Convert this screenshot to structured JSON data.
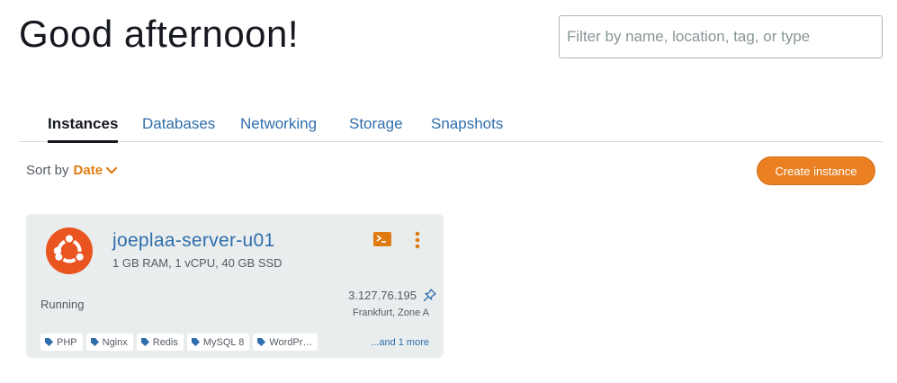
{
  "header": {
    "greeting": "Good afternoon!",
    "filter_placeholder": "Filter by name, location, tag, or type"
  },
  "tabs": [
    {
      "label": "Instances",
      "active": true
    },
    {
      "label": "Databases",
      "active": false
    },
    {
      "label": "Networking",
      "active": false
    },
    {
      "label": "Storage",
      "active": false
    },
    {
      "label": "Snapshots",
      "active": false
    }
  ],
  "toolbar": {
    "sort_label": "Sort by",
    "sort_value": "Date",
    "create_label": "Create instance"
  },
  "instance": {
    "name": "joeplaa-server-u01",
    "specs": "1 GB RAM, 1 vCPU, 40 GB SSD",
    "status": "Running",
    "ip": "3.127.76.195",
    "location": "Frankfurt, Zone A",
    "os_icon": "ubuntu-logo-icon",
    "tags": [
      "PHP",
      "Nginx",
      "Redis",
      "MySQL 8",
      "WordPr…"
    ],
    "more_tags": "...and 1 more"
  },
  "colors": {
    "accent_orange": "#eb8022",
    "link_blue": "#2f6ead",
    "ubuntu_orange": "#e95420",
    "card_bg": "#eaeded"
  }
}
